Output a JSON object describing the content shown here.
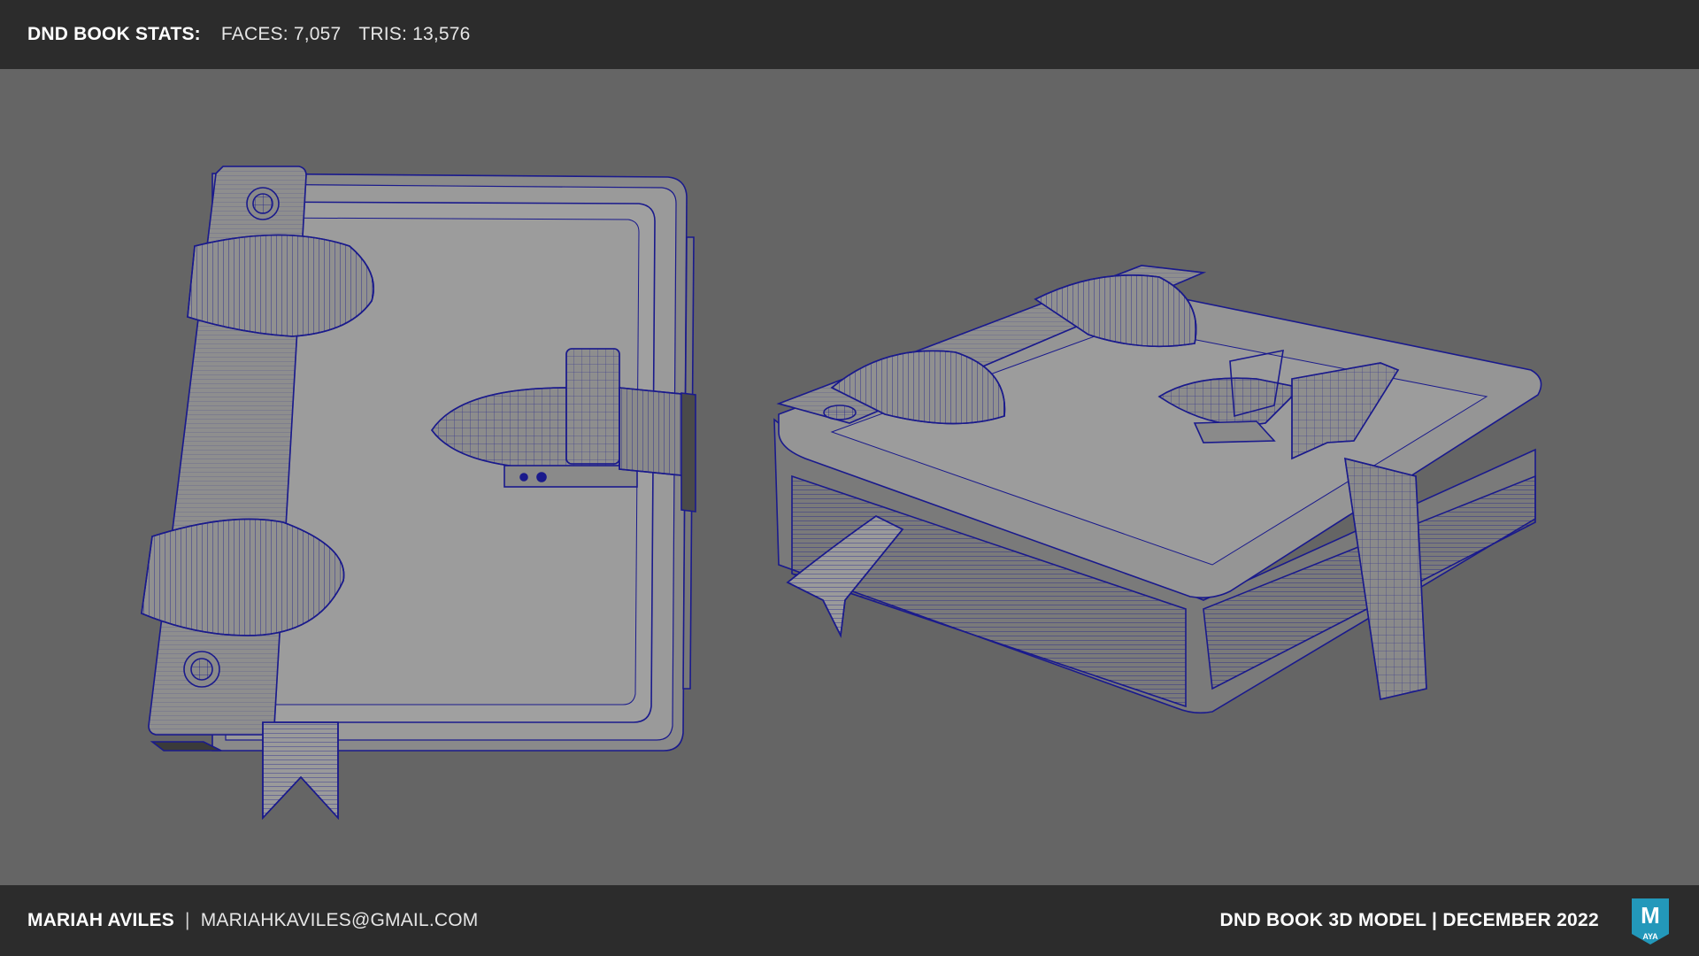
{
  "header": {
    "stats_label": "DND BOOK STATS:",
    "faces": "FACES: 7,057",
    "tris": "TRIS: 13,576"
  },
  "footer": {
    "author": "MARIAH AVILES",
    "separator": "|",
    "email": "MARIAHKAVILES@GMAIL.COM",
    "project": "DND BOOK 3D MODEL | DECEMBER 2022",
    "logo_letter": "M",
    "logo_text": "AYA"
  },
  "colors": {
    "bar_background": "#2c2c2c",
    "viewport_background": "#656565",
    "wireframe": "#1a1a8c",
    "logo_accent": "#27a6c9"
  },
  "icons": {
    "app_logo": "maya-logo-icon"
  }
}
